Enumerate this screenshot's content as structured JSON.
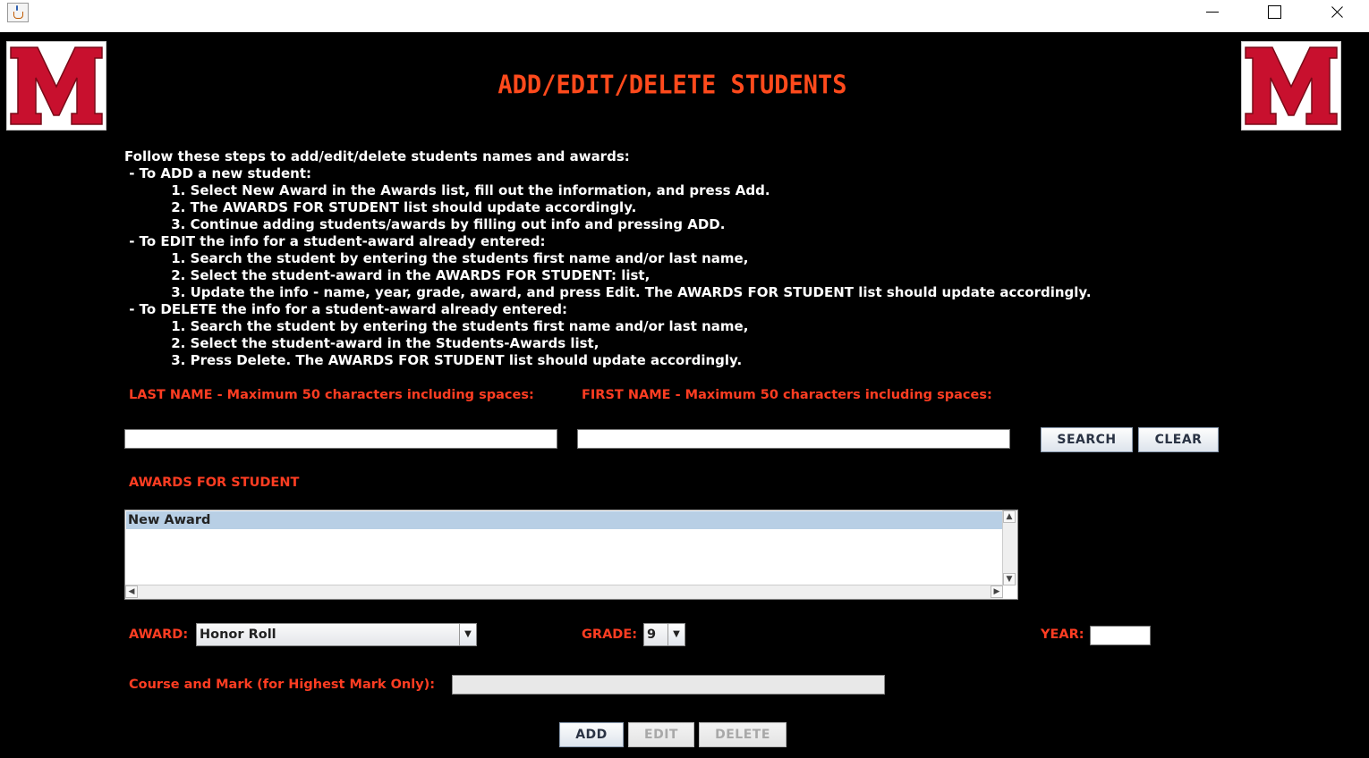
{
  "window": {
    "app_icon": "java-cup-icon"
  },
  "logo": {
    "letter": "M",
    "color": "#c8102e"
  },
  "header": {
    "title": "ADD/EDIT/DELETE STUDENTS"
  },
  "instructions": [
    "Follow these steps to add/edit/delete students names and awards:",
    " - To ADD a new student:",
    "          1. Select New Award in the Awards list, fill out the information, and press Add.",
    "          2. The AWARDS FOR STUDENT list should update accordingly.",
    "          3. Continue adding students/awards by filling out info and pressing ADD.",
    " - To EDIT the info for a student-award already entered:",
    "          1. Search the student by entering the students first name and/or last name,",
    "          2. Select the student-award in the AWARDS FOR STUDENT: list,",
    "          3. Update the info - name, year, grade, award, and press Edit. The AWARDS FOR STUDENT list should update accordingly.",
    " - To DELETE the info for a student-award already entered:",
    "          1. Search the student by entering the students first name and/or last name,",
    "          2. Select the student-award in the Students-Awards list,",
    "          3. Press Delete. The AWARDS FOR STUDENT list should update accordingly."
  ],
  "search": {
    "last_name_label": "LAST NAME - Maximum 50 characters including spaces:",
    "first_name_label": "FIRST NAME - Maximum 50 characters including spaces:",
    "last_name_value": "",
    "first_name_value": "",
    "search_label": "SEARCH",
    "clear_label": "CLEAR"
  },
  "awards": {
    "label": "AWARDS FOR STUDENT",
    "items": [
      "New Award"
    ]
  },
  "form": {
    "award_label": "AWARD:",
    "award_value": "Honor Roll",
    "grade_label": "GRADE:",
    "grade_value": "9",
    "year_label": "YEAR:",
    "year_value": "",
    "course_label": "Course and Mark (for Highest Mark Only):",
    "course_value": ""
  },
  "actions": {
    "add_label": "ADD",
    "edit_label": "EDIT",
    "delete_label": "DELETE"
  },
  "colors": {
    "accent": "#ff3d22",
    "background": "#000000",
    "selection": "#b8cfe5"
  }
}
